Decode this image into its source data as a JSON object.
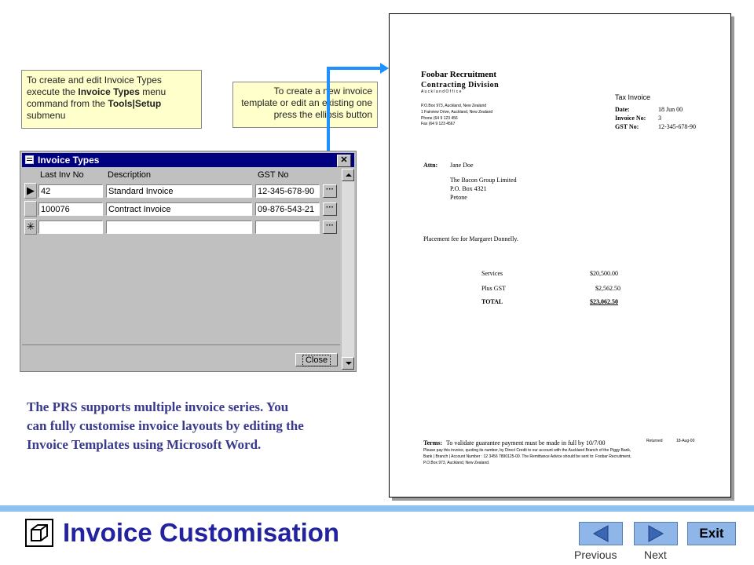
{
  "callouts": {
    "left": {
      "p1": "To create and edit Invoice Types execute the ",
      "b1": "Invoice Types",
      "p2": " menu command from  the ",
      "b2": "Tools|Setup",
      "p3": " submenu"
    },
    "right": "To create a new invoice template or edit an existing one press the ellipsis button"
  },
  "dialog": {
    "title": "Invoice Types",
    "close_x": "✕",
    "columns": [
      "Last Inv No",
      "Description",
      "GST No"
    ],
    "rows": [
      {
        "selector": "▶",
        "last_inv_no": "42",
        "description": "Standard Invoice",
        "gst_no": "12-345-678-90",
        "ellipsis": "···"
      },
      {
        "selector": "",
        "last_inv_no": "100076",
        "description": "Contract Invoice",
        "gst_no": "09-876-543-21",
        "ellipsis": "···"
      },
      {
        "selector": "✳",
        "last_inv_no": "",
        "description": "",
        "gst_no": "",
        "ellipsis": "···"
      }
    ],
    "close_button": "Close"
  },
  "invoice": {
    "company": "Foobar Recruitment",
    "division": "Contracting Division",
    "office": "A u c k l a n d   O f f i c e",
    "addr1": "P.O.Box 973, Auckland, New Zealand",
    "addr2": "1 Fairview Drive, Auckland, New Zealand",
    "phone": "Phone (64 9 123 456",
    "fax": "Fax (64 9 123 4567",
    "tax_invoice": "Tax Invoice",
    "date_label": "Date:",
    "date_value": "18 Jun 00",
    "invno_label": "Invoice No:",
    "invno_value": "3",
    "gst_label": "GST No:",
    "gst_value": "12-345-678-90",
    "attn_label": "Attn:",
    "attn_name": "Jane Doe",
    "to1": "The Bacon Group Limited",
    "to2": "P.O. Box 4321",
    "to3": "Petone",
    "placement": "Placement fee for Margaret Donnelly.",
    "services_label": "Services",
    "services_value": "$20,500.00",
    "plus_gst_label": "Plus GST",
    "plus_gst_value": "$2,562.50",
    "total_label": "TOTAL",
    "total_value": "$23,062.50",
    "terms_label": "Terms:",
    "terms_text": "To validate guarantee payment must be made in full by 10/7/00",
    "returned_label": "Returned",
    "returned_value": "18-Aug-00",
    "fine1": "Please pay this invoice, quoting its number, by Direct Credit to our account with the Auckland Branch of the Piggy Bank,",
    "fine2": "Bank | Branch | Account Number : 12 3456 7890125-00. The Remittance Advice should be sent to: Foobar Recruitment,",
    "fine3": "P.O.Box 973, Auckland, New Zealand."
  },
  "body_text": "The PRS supports multiple invoice series. You can fully customise invoice layouts by editing the Invoice Templates using Microsoft Word.",
  "footer": {
    "title": "Invoice Customisation",
    "previous": "Previous",
    "next": "Next",
    "exit": "Exit"
  },
  "colors": {
    "accent": "#1e90ff",
    "footer_bar": "#8ec0ee",
    "title_color": "#2323a0",
    "body_color": "#3a3a8c",
    "dialog_titlebar": "#000080"
  }
}
